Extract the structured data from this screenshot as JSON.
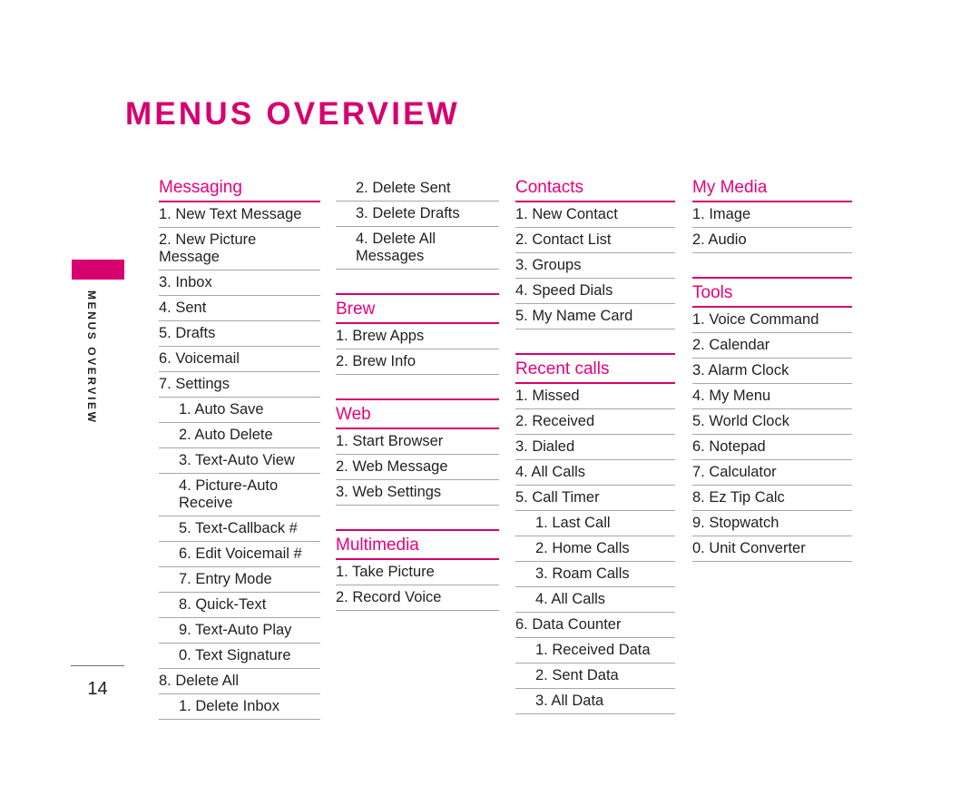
{
  "page": {
    "title": "MENUS OVERVIEW",
    "sidebar_tab_label": "MENUS OVERVIEW",
    "number": "14",
    "accent_color": "#d6006e",
    "heading_color": "#e6007e",
    "divider_color": "#a7a7a7",
    "text_color": "#231f20",
    "background_color": "#ffffff"
  },
  "columns": [
    {
      "sections": [
        {
          "id": "messaging",
          "title": "Messaging",
          "rule_above": false,
          "items": [
            {
              "text": "1. New Text Message",
              "level": 1
            },
            {
              "text": "2. New Picture Message",
              "level": 1
            },
            {
              "text": "3. Inbox",
              "level": 1
            },
            {
              "text": "4. Sent",
              "level": 1
            },
            {
              "text": "5. Drafts",
              "level": 1
            },
            {
              "text": "6. Voicemail",
              "level": 1
            },
            {
              "text": "7. Settings",
              "level": 1
            },
            {
              "text": "1. Auto Save",
              "level": 2
            },
            {
              "text": "2. Auto Delete",
              "level": 2
            },
            {
              "text": "3. Text-Auto View",
              "level": 2
            },
            {
              "text": "4. Picture-Auto\n    Receive",
              "level": 2
            },
            {
              "text": "5. Text-Callback #",
              "level": 2
            },
            {
              "text": "6. Edit Voicemail #",
              "level": 2
            },
            {
              "text": "7. Entry Mode",
              "level": 2
            },
            {
              "text": "8. Quick-Text",
              "level": 2
            },
            {
              "text": "9. Text-Auto Play",
              "level": 2
            },
            {
              "text": "0. Text Signature",
              "level": 2
            },
            {
              "text": "8. Delete All",
              "level": 1
            },
            {
              "text": "1. Delete Inbox",
              "level": 2
            }
          ]
        }
      ]
    },
    {
      "sections": [
        {
          "id": "messaging-continued",
          "title": "",
          "rule_above": false,
          "continuation": true,
          "items": [
            {
              "text": "2. Delete Sent",
              "level": 2
            },
            {
              "text": "3. Delete Drafts",
              "level": 2
            },
            {
              "text": "4. Delete All Messages",
              "level": 2
            }
          ]
        },
        {
          "id": "brew",
          "title": "Brew",
          "rule_above": true,
          "items": [
            {
              "text": "1. Brew Apps",
              "level": 1
            },
            {
              "text": "2. Brew Info",
              "level": 1
            }
          ]
        },
        {
          "id": "web",
          "title": "Web",
          "rule_above": true,
          "items": [
            {
              "text": "1. Start Browser",
              "level": 1
            },
            {
              "text": "2. Web Message",
              "level": 1
            },
            {
              "text": "3. Web Settings",
              "level": 1
            }
          ]
        },
        {
          "id": "multimedia",
          "title": "Multimedia",
          "rule_above": true,
          "items": [
            {
              "text": "1. Take Picture",
              "level": 1
            },
            {
              "text": "2. Record Voice",
              "level": 1
            }
          ]
        }
      ]
    },
    {
      "sections": [
        {
          "id": "contacts",
          "title": "Contacts",
          "rule_above": false,
          "items": [
            {
              "text": "1. New Contact",
              "level": 1
            },
            {
              "text": "2. Contact List",
              "level": 1
            },
            {
              "text": "3. Groups",
              "level": 1
            },
            {
              "text": "4. Speed Dials",
              "level": 1
            },
            {
              "text": "5. My Name Card",
              "level": 1
            }
          ]
        },
        {
          "id": "recent-calls",
          "title": "Recent calls",
          "rule_above": true,
          "items": [
            {
              "text": "1. Missed",
              "level": 1
            },
            {
              "text": "2. Received",
              "level": 1
            },
            {
              "text": "3. Dialed",
              "level": 1
            },
            {
              "text": "4. All Calls",
              "level": 1
            },
            {
              "text": "5. Call Timer",
              "level": 1
            },
            {
              "text": "1. Last Call",
              "level": 2
            },
            {
              "text": "2. Home Calls",
              "level": 2
            },
            {
              "text": "3. Roam Calls",
              "level": 2
            },
            {
              "text": "4. All Calls",
              "level": 2
            },
            {
              "text": "6. Data Counter",
              "level": 1
            },
            {
              "text": "1. Received Data",
              "level": 2
            },
            {
              "text": "2. Sent Data",
              "level": 2
            },
            {
              "text": "3. All Data",
              "level": 2
            }
          ]
        }
      ]
    },
    {
      "sections": [
        {
          "id": "my-media",
          "title": "My Media",
          "rule_above": false,
          "items": [
            {
              "text": "1. Image",
              "level": 1
            },
            {
              "text": "2. Audio",
              "level": 1
            }
          ]
        },
        {
          "id": "tools",
          "title": "Tools",
          "rule_above": true,
          "items": [
            {
              "text": "1. Voice Command",
              "level": 1
            },
            {
              "text": "2. Calendar",
              "level": 1
            },
            {
              "text": "3. Alarm Clock",
              "level": 1
            },
            {
              "text": "4. My Menu",
              "level": 1
            },
            {
              "text": "5. World Clock",
              "level": 1
            },
            {
              "text": "6. Notepad",
              "level": 1
            },
            {
              "text": "7. Calculator",
              "level": 1
            },
            {
              "text": "8. Ez Tip Calc",
              "level": 1
            },
            {
              "text": "9. Stopwatch",
              "level": 1
            },
            {
              "text": "0. Unit Converter",
              "level": 1
            }
          ]
        }
      ]
    }
  ]
}
